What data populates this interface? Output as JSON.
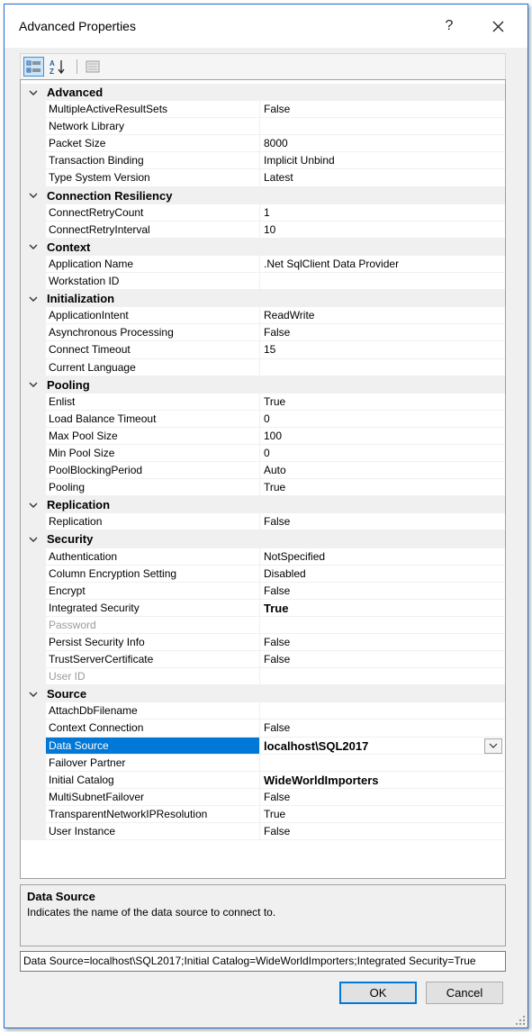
{
  "window": {
    "title": "Advanced Properties",
    "help_label": "?"
  },
  "toolbar": {
    "buttons": [
      "categorized-icon",
      "alphabetical-icon",
      "property-pages-icon"
    ]
  },
  "categories": [
    {
      "name": "Advanced",
      "properties": [
        {
          "name": "MultipleActiveResultSets",
          "value": "False"
        },
        {
          "name": "Network Library",
          "value": ""
        },
        {
          "name": "Packet Size",
          "value": "8000"
        },
        {
          "name": "Transaction Binding",
          "value": "Implicit Unbind"
        },
        {
          "name": "Type System Version",
          "value": "Latest"
        }
      ]
    },
    {
      "name": "Connection Resiliency",
      "properties": [
        {
          "name": "ConnectRetryCount",
          "value": "1"
        },
        {
          "name": "ConnectRetryInterval",
          "value": "10"
        }
      ]
    },
    {
      "name": "Context",
      "properties": [
        {
          "name": "Application Name",
          "value": ".Net SqlClient Data Provider"
        },
        {
          "name": "Workstation ID",
          "value": ""
        }
      ]
    },
    {
      "name": "Initialization",
      "properties": [
        {
          "name": "ApplicationIntent",
          "value": "ReadWrite"
        },
        {
          "name": "Asynchronous Processing",
          "value": "False"
        },
        {
          "name": "Connect Timeout",
          "value": "15"
        },
        {
          "name": "Current Language",
          "value": ""
        }
      ]
    },
    {
      "name": "Pooling",
      "properties": [
        {
          "name": "Enlist",
          "value": "True"
        },
        {
          "name": "Load Balance Timeout",
          "value": "0"
        },
        {
          "name": "Max Pool Size",
          "value": "100"
        },
        {
          "name": "Min Pool Size",
          "value": "0"
        },
        {
          "name": "PoolBlockingPeriod",
          "value": "Auto"
        },
        {
          "name": "Pooling",
          "value": "True"
        }
      ]
    },
    {
      "name": "Replication",
      "properties": [
        {
          "name": "Replication",
          "value": "False"
        }
      ]
    },
    {
      "name": "Security",
      "properties": [
        {
          "name": "Authentication",
          "value": "NotSpecified"
        },
        {
          "name": "Column Encryption Setting",
          "value": "Disabled"
        },
        {
          "name": "Encrypt",
          "value": "False"
        },
        {
          "name": "Integrated Security",
          "value": "True",
          "bold": true
        },
        {
          "name": "Password",
          "value": "",
          "disabled": true
        },
        {
          "name": "Persist Security Info",
          "value": "False"
        },
        {
          "name": "TrustServerCertificate",
          "value": "False"
        },
        {
          "name": "User ID",
          "value": "",
          "disabled": true
        }
      ]
    },
    {
      "name": "Source",
      "properties": [
        {
          "name": "AttachDbFilename",
          "value": ""
        },
        {
          "name": "Context Connection",
          "value": "False"
        },
        {
          "name": "Data Source",
          "value": "localhost\\SQL2017",
          "bold": true,
          "selected": true
        },
        {
          "name": "Failover Partner",
          "value": ""
        },
        {
          "name": "Initial Catalog",
          "value": "WideWorldImporters",
          "bold": true
        },
        {
          "name": "MultiSubnetFailover",
          "value": "False"
        },
        {
          "name": "TransparentNetworkIPResolution",
          "value": "True"
        },
        {
          "name": "User Instance",
          "value": "False"
        }
      ]
    }
  ],
  "description": {
    "title": "Data Source",
    "text": "Indicates the name of the data source to connect to."
  },
  "connection_string": "Data Source=localhost\\SQL2017;Initial Catalog=WideWorldImporters;Integrated Security=True",
  "buttons": {
    "ok_label": "OK",
    "cancel_label": "Cancel"
  },
  "colors": {
    "selection": "#0078d7",
    "border_accent": "#1f6fd0"
  }
}
